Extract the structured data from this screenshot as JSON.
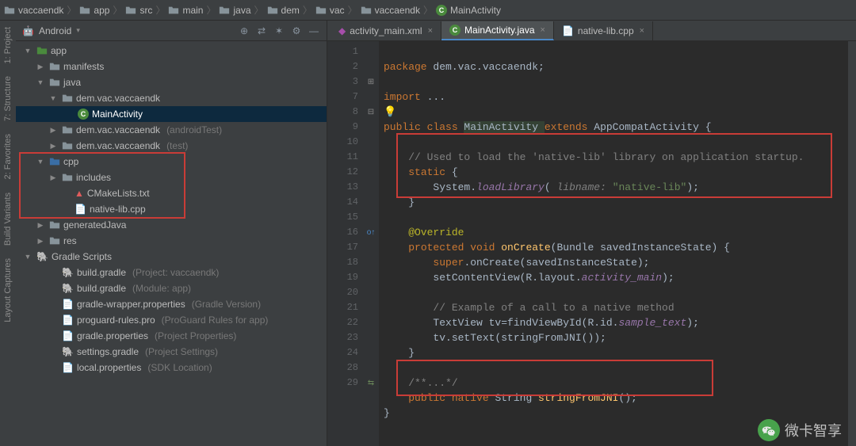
{
  "breadcrumbs": [
    "vaccaendk",
    "app",
    "src",
    "main",
    "java",
    "dem",
    "vac",
    "vaccaendk",
    "MainActivity"
  ],
  "panel": {
    "mode": "Android",
    "side_tabs": [
      "1: Project",
      "7: Structure",
      "2: Favorites",
      "Build Variants",
      "Layout Captures"
    ]
  },
  "tree": {
    "app": "app",
    "manifests": "manifests",
    "java": "java",
    "pkg_main": "dem.vac.vaccaendk",
    "main_activity": "MainActivity",
    "pkg_at": "dem.vac.vaccaendk",
    "pkg_at_hint": "(androidTest)",
    "pkg_test": "dem.vac.vaccaendk",
    "pkg_test_hint": "(test)",
    "cpp": "cpp",
    "includes": "includes",
    "cmake": "CMakeLists.txt",
    "nativelib": "native-lib.cpp",
    "generated": "generatedJava",
    "res": "res",
    "gradle_scripts": "Gradle Scripts",
    "bg1": "build.gradle",
    "bg1_hint": "(Project: vaccaendk)",
    "bg2": "build.gradle",
    "bg2_hint": "(Module: app)",
    "gwp": "gradle-wrapper.properties",
    "gwp_hint": "(Gradle Version)",
    "pgr": "proguard-rules.pro",
    "pgr_hint": "(ProGuard Rules for app)",
    "gp": "gradle.properties",
    "gp_hint": "(Project Properties)",
    "sg": "settings.gradle",
    "sg_hint": "(Project Settings)",
    "lp": "local.properties",
    "lp_hint": "(SDK Location)"
  },
  "tabs": {
    "t1": "activity_main.xml",
    "t2": "MainActivity.java",
    "t3": "native-lib.cpp"
  },
  "code": {
    "l1_a": "package",
    "l1_b": " dem.vac.vaccaendk;",
    "l3_a": "import",
    "l3_b": " ...",
    "l7_a": "public class ",
    "l7_b": "MainActivity ",
    "l7_c": "extends ",
    "l7_d": "AppCompatActivity {",
    "l9": "    // Used to load the 'native-lib' library on application startup.",
    "l10_a": "    ",
    "l10_b": "static",
    " l10_c": " {",
    "l11_a": "        System.",
    "l11_b": "loadLibrary",
    "l11_c": "( ",
    "l11_d": "libname: ",
    "l11_e": "\"native-lib\"",
    "l11_f": ");",
    "l12": "    }",
    "l14": "    @Override",
    "l15_a": "    ",
    "l15_b": "protected void ",
    "l15_c": "onCreate",
    "l15_d": "(Bundle savedInstanceState) {",
    "l16_a": "        ",
    "l16_b": "super",
    "l16_c": ".onCreate(savedInstanceState);",
    "l17_a": "        setContentView(R.layout.",
    "l17_b": "activity_main",
    "l17_c": ");",
    "l19": "        // Example of a call to a native method",
    "l20_a": "        TextView tv=findViewById(R.id.",
    "l20_b": "sample_text",
    "l20_c": ");",
    "l21": "        tv.setText(stringFromJNI());",
    "l22": "    }",
    "l24": "    /**...*/",
    "l28_a": "    ",
    "l28_b": "public native ",
    "l28_c": "String ",
    "l28_d": "stringFromJNI",
    "l28_e": "();",
    "l29": "}"
  },
  "line_numbers": [
    "1",
    "2",
    "3",
    "",
    "7",
    "8",
    "9",
    "10",
    "11",
    "12",
    "13",
    "14",
    "15",
    "16",
    "17",
    "18",
    "19",
    "20",
    "21",
    "22",
    "23",
    "24",
    "28",
    "29"
  ],
  "watermark": "微卡智享"
}
